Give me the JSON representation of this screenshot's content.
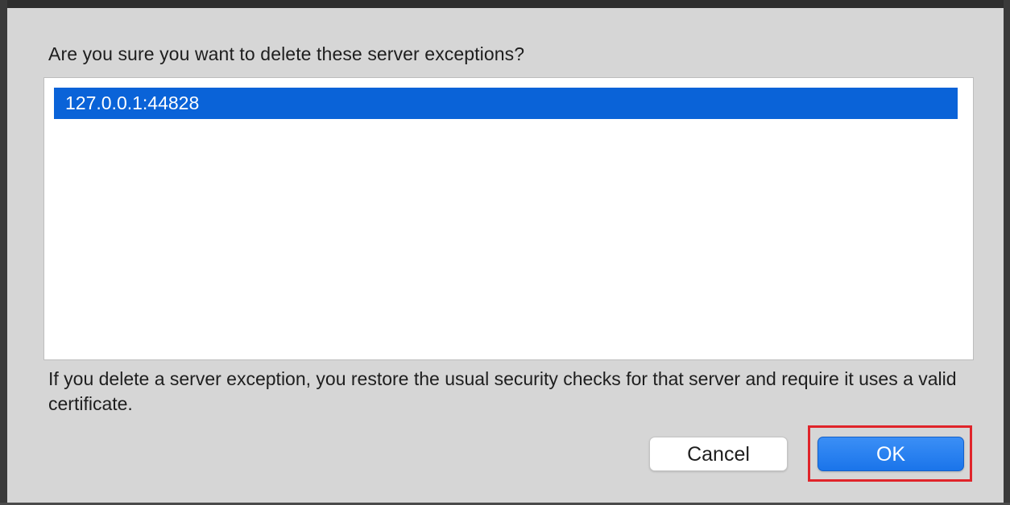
{
  "dialog": {
    "prompt": "Are you sure you want to delete these server exceptions?",
    "exceptions": [
      {
        "label": "127.0.0.1:44828",
        "selected": true
      }
    ],
    "info": "If you delete a server exception, you restore the usual security checks for that server and require it uses a valid certificate.",
    "buttons": {
      "cancel_label": "Cancel",
      "ok_label": "OK"
    }
  },
  "colors": {
    "selection": "#0a63d8",
    "primary_button": "#1a74ea",
    "highlight": "#e0242a"
  }
}
